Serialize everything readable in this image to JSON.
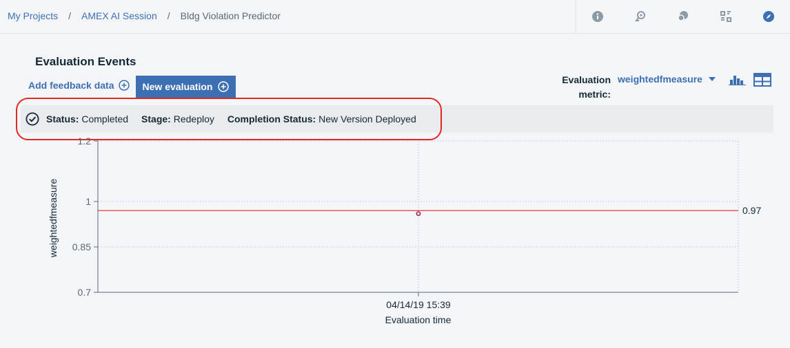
{
  "breadcrumb": {
    "items": [
      "My Projects",
      "AMEX AI Session"
    ],
    "current": "Bldg Violation Predictor",
    "separator": "/"
  },
  "toolbar": {
    "icons": [
      "info-icon",
      "reset-icon",
      "chat-icon",
      "scan-icon",
      "compass-icon"
    ]
  },
  "page": {
    "title": "Evaluation Events",
    "add_feedback_label": "Add feedback data",
    "new_evaluation_label": "New evaluation",
    "metric_label_line1": "Evaluation",
    "metric_label_line2": "metric:",
    "metric_value": "weightedfmeasure"
  },
  "status": {
    "status_key": "Status:",
    "status_value": "Completed",
    "stage_key": "Stage:",
    "stage_value": "Redeploy",
    "completion_key": "Completion Status:",
    "completion_value": "New Version Deployed"
  },
  "colors": {
    "accent": "#3d70b2",
    "threshold": "#e0281e",
    "point": "#a2194e"
  },
  "chart_data": {
    "type": "scatter",
    "xlabel": "Evaluation time",
    "ylabel": "weightedfmeasure",
    "categories": [
      "04/14/19 15:39"
    ],
    "values": [
      0.96
    ],
    "ylim": [
      0.7,
      1.2
    ],
    "yticks": [
      1.2,
      1,
      0.85,
      0.7
    ],
    "threshold": 0.97,
    "threshold_label": "0.97",
    "grid": true
  }
}
